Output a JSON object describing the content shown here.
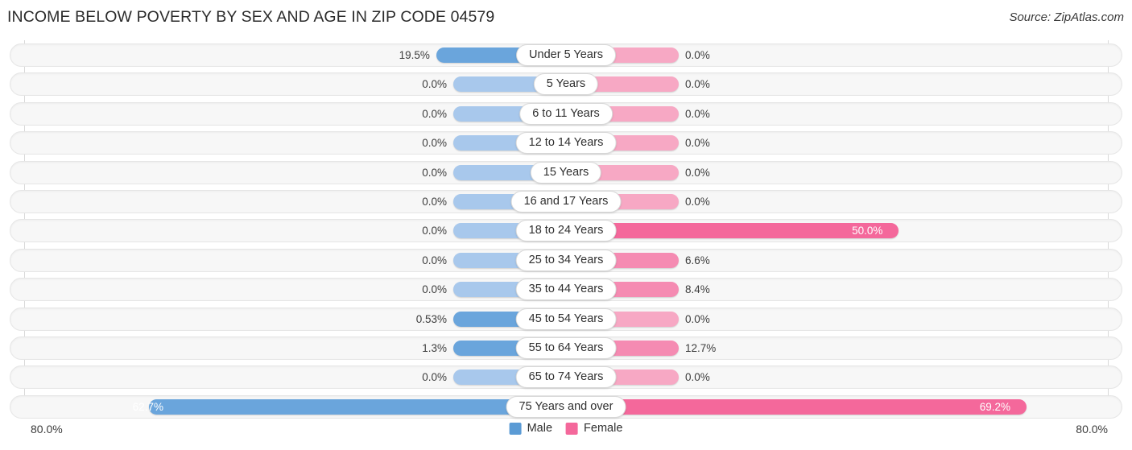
{
  "header": {
    "title": "INCOME BELOW POVERTY BY SEX AND AGE IN ZIP CODE 04579",
    "source": "Source: ZipAtlas.com"
  },
  "axis": {
    "left_label": "80.0%",
    "right_label": "80.0%",
    "max": 80.0
  },
  "legend": {
    "items": [
      {
        "label": "Male",
        "color": "#5b9bd5"
      },
      {
        "label": "Female",
        "color": "#f4689b"
      }
    ]
  },
  "colors": {
    "male_strong": "#6aa5dc",
    "male_light": "#a8c8ec",
    "female_strong": "#f4689b",
    "female_mid": "#f58bb2",
    "female_light": "#f7a8c4",
    "track": "#f7f7f7",
    "track_border": "#e6e6e6"
  },
  "chart_data": {
    "type": "bar",
    "subtype": "diverging-population-pyramid",
    "title": "INCOME BELOW POVERTY BY SEX AND AGE IN ZIP CODE 04579",
    "xlabel": "",
    "ylabel": "",
    "xlim": [
      -80.0,
      80.0
    ],
    "grid": false,
    "legend_position": "bottom-center",
    "categories": [
      "Under 5 Years",
      "5 Years",
      "6 to 11 Years",
      "12 to 14 Years",
      "15 Years",
      "16 and 17 Years",
      "18 to 24 Years",
      "25 to 34 Years",
      "35 to 44 Years",
      "45 to 54 Years",
      "55 to 64 Years",
      "65 to 74 Years",
      "75 Years and over"
    ],
    "series": [
      {
        "name": "Male",
        "values": [
          19.5,
          0.0,
          0.0,
          0.0,
          0.0,
          0.0,
          0.0,
          0.0,
          0.0,
          0.53,
          1.3,
          0.0,
          62.7
        ]
      },
      {
        "name": "Female",
        "values": [
          0.0,
          0.0,
          0.0,
          0.0,
          0.0,
          0.0,
          50.0,
          6.6,
          8.4,
          0.0,
          12.7,
          0.0,
          69.2
        ]
      }
    ]
  },
  "rows": [
    {
      "label": "Under 5 Years",
      "male": 19.5,
      "female": 0.0,
      "male_text": "19.5%",
      "female_text": "0.0%"
    },
    {
      "label": "5 Years",
      "male": 0.0,
      "female": 0.0,
      "male_text": "0.0%",
      "female_text": "0.0%"
    },
    {
      "label": "6 to 11 Years",
      "male": 0.0,
      "female": 0.0,
      "male_text": "0.0%",
      "female_text": "0.0%"
    },
    {
      "label": "12 to 14 Years",
      "male": 0.0,
      "female": 0.0,
      "male_text": "0.0%",
      "female_text": "0.0%"
    },
    {
      "label": "15 Years",
      "male": 0.0,
      "female": 0.0,
      "male_text": "0.0%",
      "female_text": "0.0%"
    },
    {
      "label": "16 and 17 Years",
      "male": 0.0,
      "female": 0.0,
      "male_text": "0.0%",
      "female_text": "0.0%"
    },
    {
      "label": "18 to 24 Years",
      "male": 0.0,
      "female": 50.0,
      "male_text": "0.0%",
      "female_text": "50.0%"
    },
    {
      "label": "25 to 34 Years",
      "male": 0.0,
      "female": 6.6,
      "male_text": "0.0%",
      "female_text": "6.6%"
    },
    {
      "label": "35 to 44 Years",
      "male": 0.0,
      "female": 8.4,
      "male_text": "0.0%",
      "female_text": "8.4%"
    },
    {
      "label": "45 to 54 Years",
      "male": 0.53,
      "female": 0.0,
      "male_text": "0.53%",
      "female_text": "0.0%"
    },
    {
      "label": "55 to 64 Years",
      "male": 1.3,
      "female": 12.7,
      "male_text": "1.3%",
      "female_text": "12.7%"
    },
    {
      "label": "65 to 74 Years",
      "male": 0.0,
      "female": 0.0,
      "male_text": "0.0%",
      "female_text": "0.0%"
    },
    {
      "label": "75 Years and over",
      "male": 62.7,
      "female": 69.2,
      "male_text": "62.7%",
      "female_text": "69.2%"
    }
  ]
}
